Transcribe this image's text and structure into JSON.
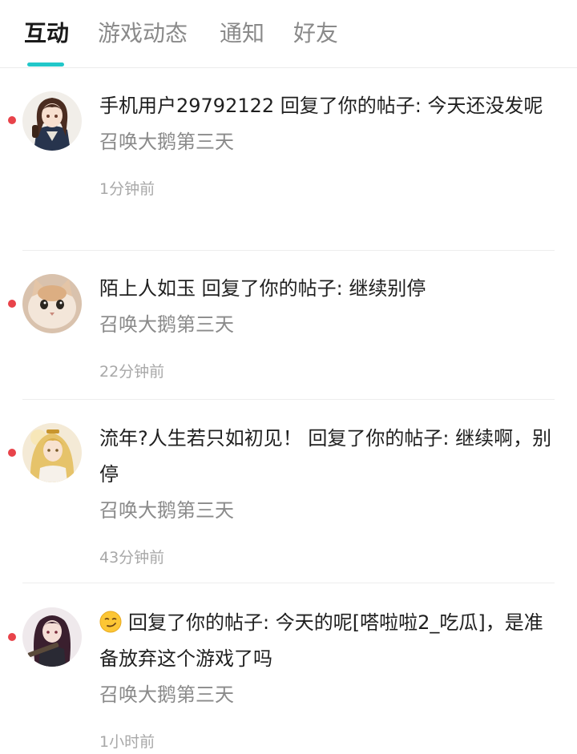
{
  "tabs": [
    {
      "label": "互动",
      "active": true
    },
    {
      "label": "游戏动态",
      "active": false
    },
    {
      "label": "通知",
      "active": false
    },
    {
      "label": "好友",
      "active": false
    }
  ],
  "colors": {
    "accent": "#22c7c9",
    "unread_dot": "#e8434a"
  },
  "notifications": [
    {
      "user": "手机用户29792122",
      "action": "回复了你的帖子:",
      "text": "今天还没发呢",
      "game": "召唤大鹅第三天",
      "time": "1分钟前",
      "unread": true,
      "avatar": "anime-girl-avatar"
    },
    {
      "user": "陌上人如玉",
      "action": "回复了你的帖子:",
      "text": "继续别停",
      "game": "召唤大鹅第三天",
      "time": "22分钟前",
      "unread": true,
      "avatar": "cat-avatar"
    },
    {
      "user": "流年?人生若只如初见！",
      "action": "回复了你的帖子:",
      "text": "继续啊，别停",
      "game": "召唤大鹅第三天",
      "time": "43分钟前",
      "unread": true,
      "avatar": "blonde-girl-avatar"
    },
    {
      "user": "",
      "user_icon": "smirk-emoji",
      "action": "回复了你的帖子:",
      "text": "今天的呢[嗒啦啦2_吃瓜]，是准备放弃这个游戏了吗",
      "game": "召唤大鹅第三天",
      "time": "1小时前",
      "unread": true,
      "avatar": "dark-hair-girl-avatar"
    }
  ]
}
